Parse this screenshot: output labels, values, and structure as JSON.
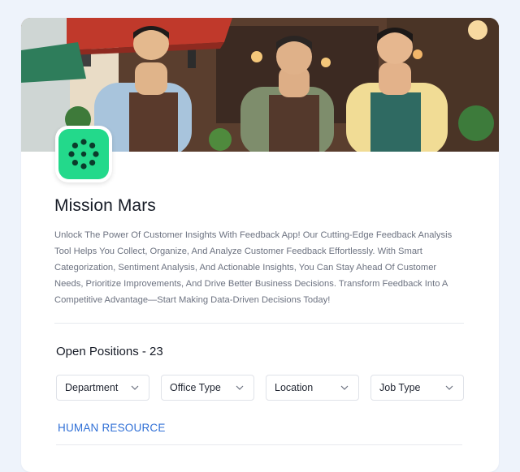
{
  "company": {
    "name": "Mission Mars",
    "description": "Unlock The Power Of Customer Insights With Feedback App! Our Cutting-Edge Feedback Analysis Tool Helps You Collect, Organize, And Analyze Customer Feedback Effortlessly. With Smart Categorization, Sentiment Analysis, And Actionable Insights, You Can Stay Ahead Of Customer Needs, Prioritize Improvements, And Drive Better Business Decisions. Transform Feedback Into A Competitive Advantage—Start Making Data-Driven Decisions Today!",
    "logo_icon": "asterisk-burst-icon",
    "logo_color": "#23d98b",
    "banner": "cafe-staff-illustration"
  },
  "positions": {
    "label": "Open Positions - 23"
  },
  "filters": [
    {
      "label": "Department"
    },
    {
      "label": "Office Type"
    },
    {
      "label": "Location"
    },
    {
      "label": "Job Type"
    }
  ],
  "sections": [
    {
      "label": "HUMAN RESOURCE"
    }
  ],
  "colors": {
    "accent": "#2f6fd6",
    "page_bg": "#eef3fb",
    "text": "#161b26",
    "muted": "#6c7280"
  }
}
